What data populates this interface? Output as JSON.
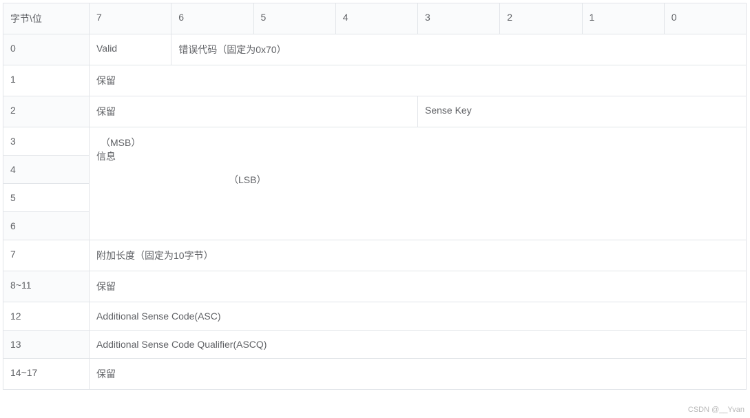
{
  "header": {
    "byte_bit": "字节\\位",
    "bits": [
      "7",
      "6",
      "5",
      "4",
      "3",
      "2",
      "1",
      "0"
    ]
  },
  "rows": {
    "r0": {
      "byte": "0",
      "valid": "Valid",
      "errcode": "错误代码（固定为0x70）"
    },
    "r1": {
      "byte": "1",
      "reserved": "保留"
    },
    "r2": {
      "byte": "2",
      "reserved": "保留",
      "sensekey": "Sense Key"
    },
    "r3": {
      "byte": "3",
      "msb": "（MSB）",
      "info": "信息",
      "lsb": "（LSB）"
    },
    "r4": {
      "byte": "4"
    },
    "r5": {
      "byte": "5"
    },
    "r6": {
      "byte": "6"
    },
    "r7": {
      "byte": "7",
      "addlen": "附加长度（固定为10字节）"
    },
    "r8_11": {
      "byte": "8~11",
      "reserved": "保留"
    },
    "r12": {
      "byte": "12",
      "asc": "Additional Sense Code(ASC)"
    },
    "r13": {
      "byte": "13",
      "ascq": "Additional Sense Code Qualifier(ASCQ)"
    },
    "r14_17": {
      "byte": "14~17",
      "reserved": "保留"
    }
  },
  "watermark": "CSDN @__Yvan"
}
